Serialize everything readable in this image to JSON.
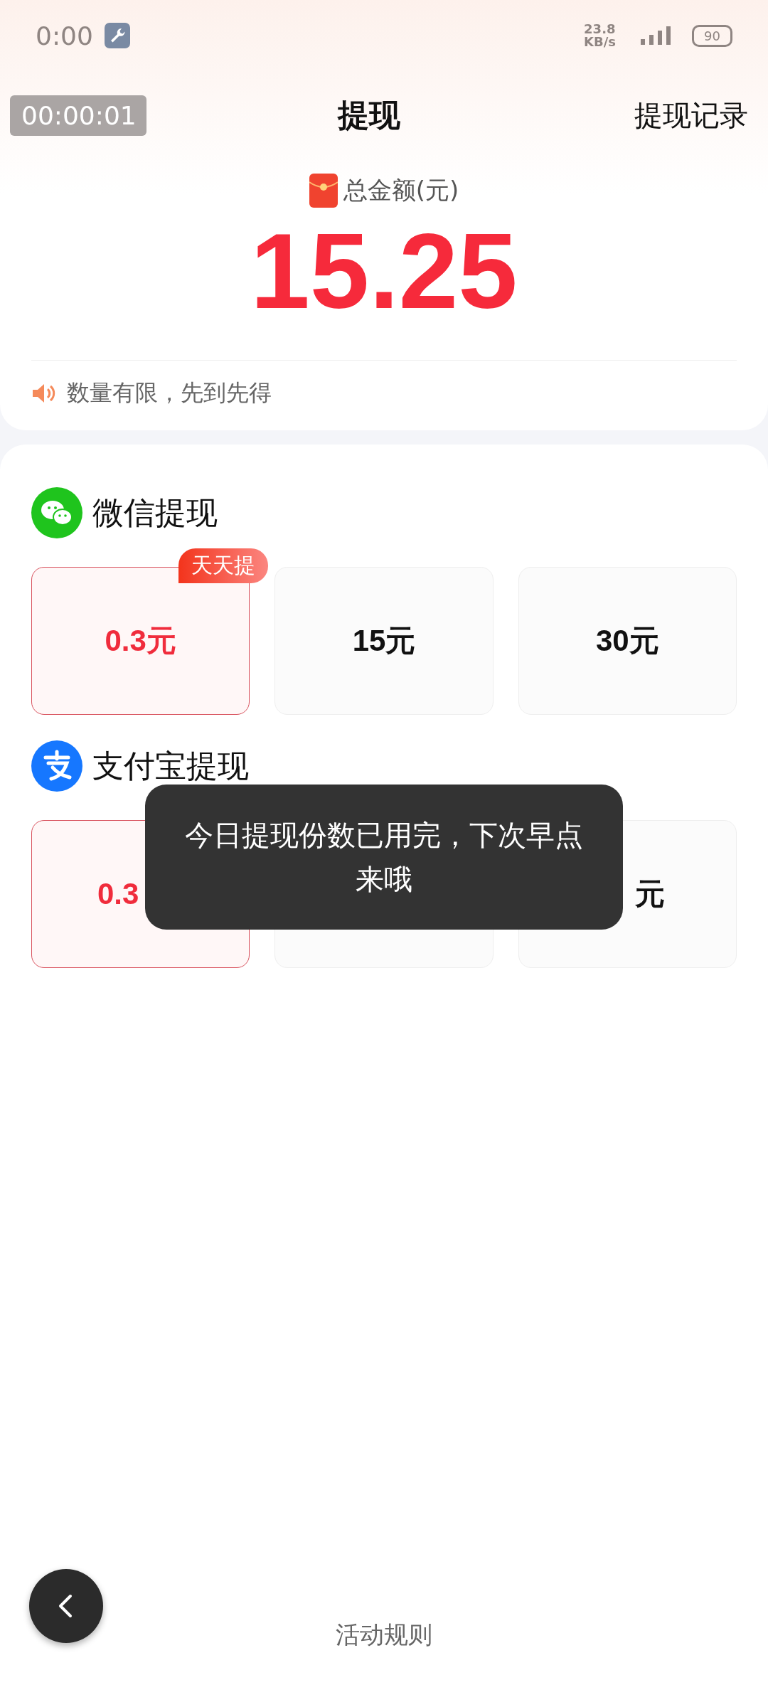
{
  "status_bar": {
    "time": "0:00",
    "net_speed": "23.8 KB/s",
    "battery": "90"
  },
  "nav": {
    "timer": "00:00:01",
    "title": "提现",
    "record_link": "提现记录"
  },
  "summary": {
    "label": "总金额(元)",
    "amount": "15.25",
    "notice": "数量有限，先到先得"
  },
  "sections": [
    {
      "kind": "wechat",
      "title": "微信提现",
      "options": [
        {
          "amount": "0.3元",
          "selected": true,
          "badge": "天天提"
        },
        {
          "amount": "15元",
          "selected": false
        },
        {
          "amount": "30元",
          "selected": false
        }
      ]
    },
    {
      "kind": "alipay",
      "title": "支付宝提现",
      "options": [
        {
          "amount": "0.3",
          "selected": true
        },
        {
          "selected": false
        },
        {
          "amount": "元",
          "selected": false
        }
      ]
    }
  ],
  "toast": "今日提现份数已用完，下次早点来哦",
  "rules_link": "活动规则"
}
